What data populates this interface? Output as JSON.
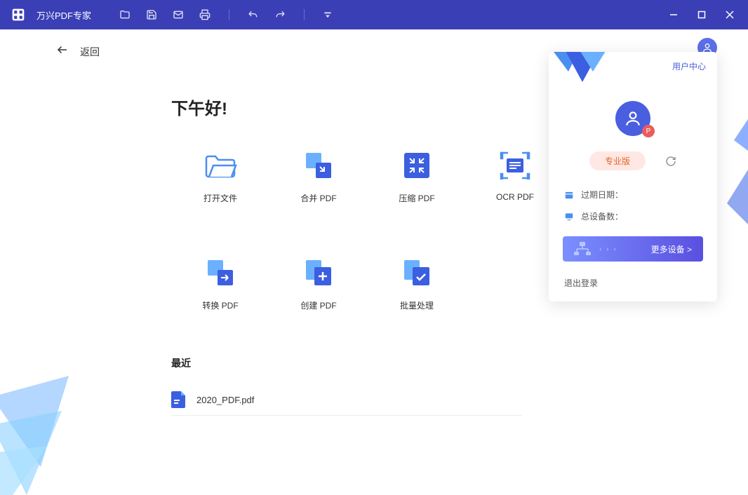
{
  "titlebar": {
    "title": "万兴PDF专家"
  },
  "back": {
    "label": "返回"
  },
  "greeting": "下午好!",
  "actions": [
    {
      "id": "open",
      "label": "打开文件"
    },
    {
      "id": "merge",
      "label": "合并 PDF"
    },
    {
      "id": "compress",
      "label": "压缩 PDF"
    },
    {
      "id": "ocr",
      "label": "OCR PDF"
    },
    {
      "id": "convert",
      "label": "转换 PDF"
    },
    {
      "id": "create",
      "label": "创建 PDF"
    },
    {
      "id": "batch",
      "label": "批量处理"
    }
  ],
  "recent": {
    "title": "最近",
    "files": [
      {
        "name": "2020_PDF.pdf"
      }
    ]
  },
  "userPanel": {
    "centerLink": "用户中心",
    "avatarBadge": "P",
    "plan": "专业版",
    "expiryLabel": "过期日期：",
    "devicesLabel": "总设备数：",
    "moreDevices": "更多设备 >",
    "logout": "退出登录"
  }
}
